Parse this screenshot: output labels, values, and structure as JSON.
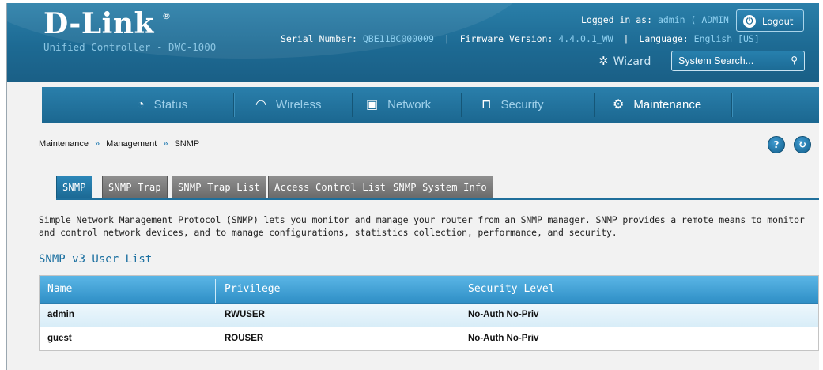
{
  "header": {
    "brand": "D-Link",
    "brand_mark": "®",
    "product": "Unified Controller - DWC-1000",
    "logged_in_label": "Logged in as:",
    "logged_in_user": "admin ( ADMIN )",
    "logout_label": "Logout",
    "serial_label": "Serial Number:",
    "serial_value": "QBE11BC000009",
    "firmware_label": "Firmware Version:",
    "firmware_value": "4.4.0.1_WW",
    "language_label": "Language:",
    "language_value": "English [US]",
    "wizard_label": "Wizard",
    "search_placeholder": "System Search..."
  },
  "nav": {
    "items": [
      {
        "label": "Status",
        "icon": "dashboard-icon"
      },
      {
        "label": "Wireless",
        "icon": "wifi-icon"
      },
      {
        "label": "Network",
        "icon": "monitor-icon"
      },
      {
        "label": "Security",
        "icon": "lock-icon"
      },
      {
        "label": "Maintenance",
        "icon": "gears-icon"
      }
    ],
    "active": "Maintenance"
  },
  "breadcrumb": {
    "items": [
      "Maintenance",
      "Management",
      "SNMP"
    ],
    "separator": "»"
  },
  "tabs": [
    {
      "label": "SNMP",
      "active": true
    },
    {
      "label": "SNMP Trap",
      "active": false
    },
    {
      "label": "SNMP Trap List",
      "active": false
    },
    {
      "label": "Access Control List",
      "active": false
    },
    {
      "label": "SNMP System Info",
      "active": false
    }
  ],
  "description": "Simple Network Management Protocol (SNMP) lets you monitor and manage your router from an SNMP manager. SNMP provides a remote means to monitor and control network devices, and to manage configurations, statistics collection, performance, and security.",
  "section_title": "SNMP v3 User List",
  "table": {
    "columns": [
      "Name",
      "Privilege",
      "Security Level"
    ],
    "rows": [
      [
        "admin",
        "RWUSER",
        "No-Auth No-Priv"
      ],
      [
        "guest",
        "ROUSER",
        "No-Auth No-Priv"
      ]
    ]
  },
  "colors": {
    "header_blue": "#1d6a93",
    "accent_light_blue": "#8fd0f0",
    "active_tab": "#1c6a95",
    "table_header": "#3a9bd0"
  }
}
